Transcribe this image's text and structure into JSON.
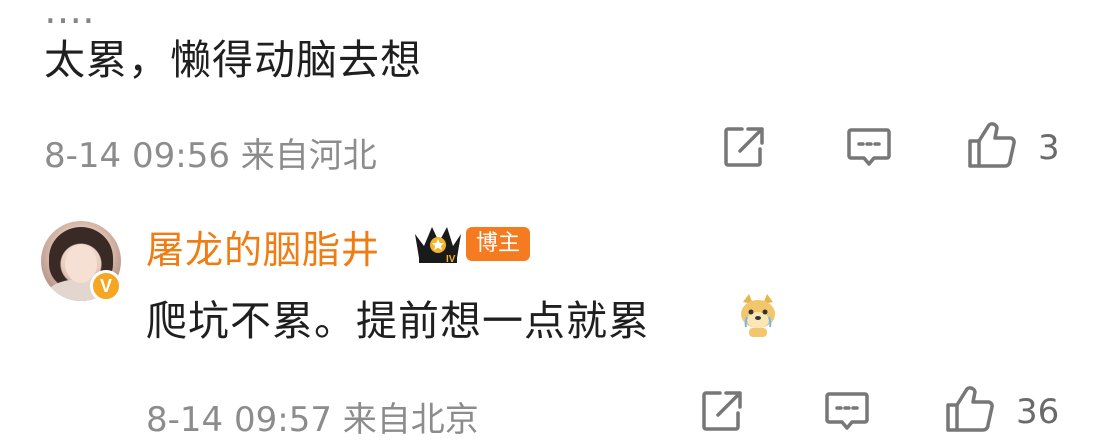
{
  "comment": {
    "text": "太累，懒得动脑去想",
    "time": "8-14 09:56",
    "location": "来自河北",
    "likes": "3"
  },
  "reply": {
    "username": "屠龙的胭脂井",
    "badge": "博主",
    "text": "爬坑不累。提前想一点就累",
    "time": "8-14 09:57",
    "location": "来自北京",
    "likes": "36"
  },
  "colors": {
    "username": "#f07d14",
    "badge_bg": "#f57b20",
    "meta": "#8c8c8c"
  },
  "icons": [
    "share-icon",
    "comment-icon",
    "like-icon",
    "vip-crown-icon",
    "verified-icon",
    "doge-emoji-icon"
  ]
}
